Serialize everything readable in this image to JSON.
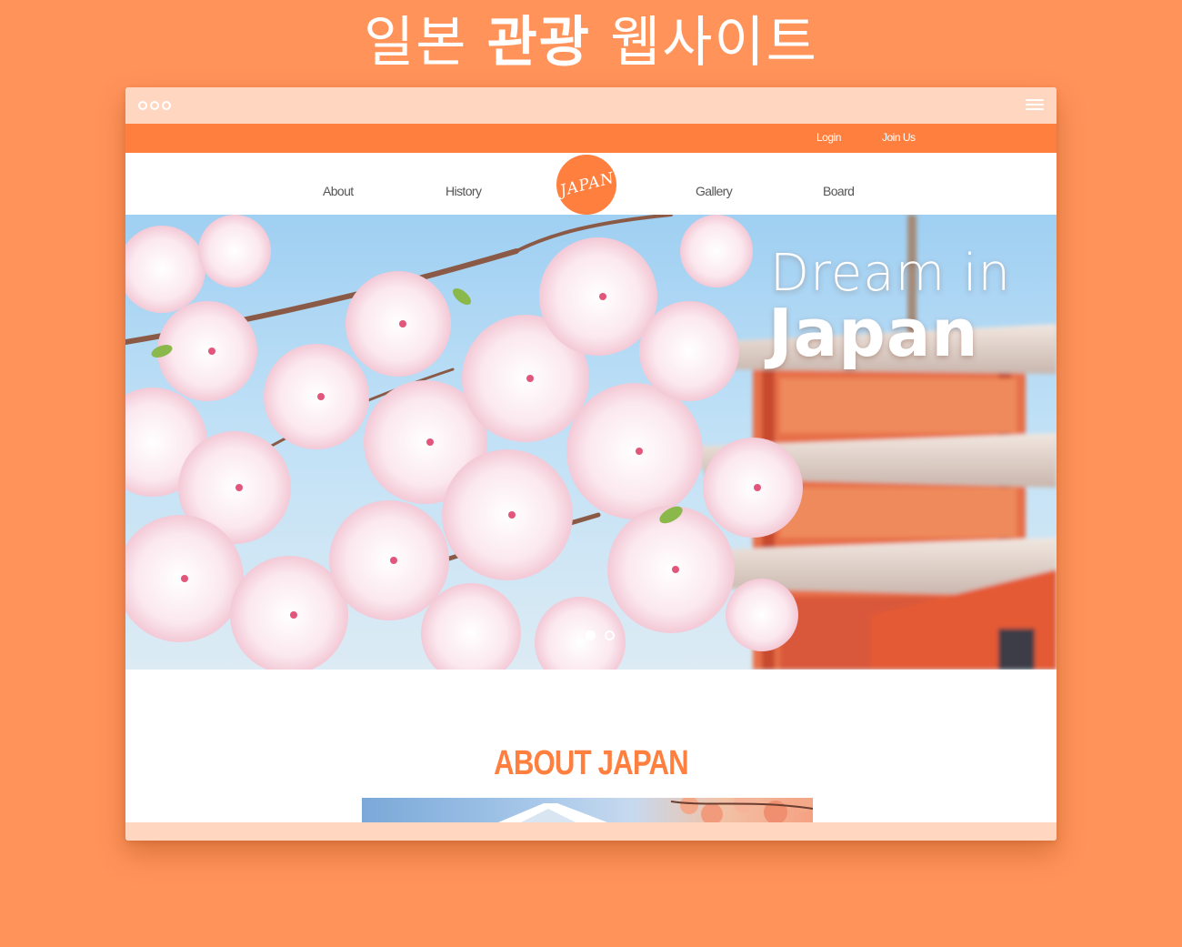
{
  "heading": {
    "light_1": "일본",
    "bold": "관광",
    "light_2": "웹사이트"
  },
  "browser": {
    "window_dots": 3,
    "menu_icon": "hamburger-menu-icon"
  },
  "topbar": {
    "login": "Login",
    "join": "Join Us"
  },
  "nav": {
    "items": [
      "About",
      "History",
      "Gallery",
      "Board"
    ],
    "logo_text": "JAPAN"
  },
  "hero": {
    "title_line1": "Dream in",
    "title_line2": "Japan",
    "slides_total": 2,
    "active_slide": 1
  },
  "about": {
    "title": "ABOUT JAPAN"
  },
  "colors": {
    "background": "#ff935a",
    "accent": "#ff7f3f",
    "bar": "#ffd6bf",
    "white": "#ffffff"
  }
}
